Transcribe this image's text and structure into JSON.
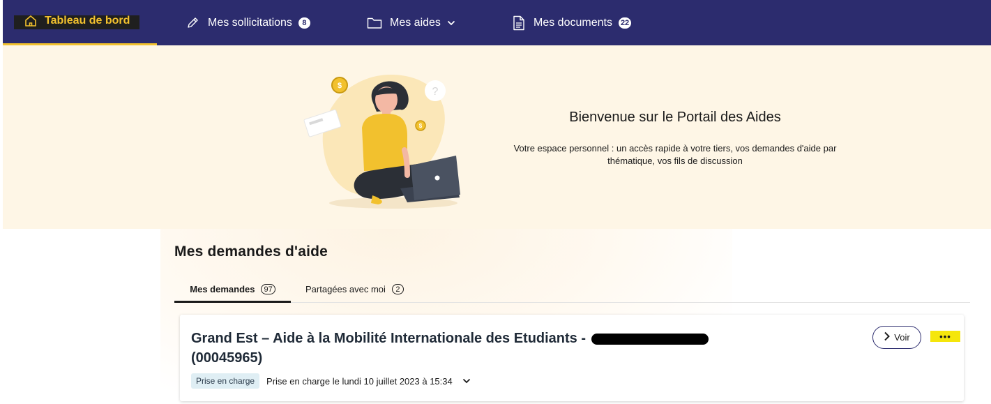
{
  "nav": {
    "home_label": "Tableau de bord",
    "items": [
      {
        "label": "Mes sollicitations",
        "badge": "8"
      },
      {
        "label": "Mes aides"
      },
      {
        "label": "Mes documents",
        "badge": "22"
      }
    ],
    "colors": {
      "background": "#2c2c6e",
      "active": "#f2c12e"
    }
  },
  "hero": {
    "title": "Bienvenue sur le Portail des Aides",
    "subtitle": "Votre espace personnel : un accès rapide à votre tiers, vos demandes d'aide par thématique, vos fils de discussion",
    "illustration": "woman-with-laptop-illustration"
  },
  "section": {
    "title": "Mes demandes d'aide"
  },
  "tabs": [
    {
      "label": "Mes demandes",
      "count": "97",
      "active": true
    },
    {
      "label": "Partagées avec moi",
      "count": "2",
      "active": false
    }
  ],
  "card": {
    "title": "Grand Est – Aide à la Mobilité Internationale des Etudiants -",
    "reference": "(00045965)",
    "voir_label": "Voir",
    "more_label": "•••",
    "status_badge": "Prise en charge",
    "status_text": "Prise en charge le lundi 10 juillet 2023 à 15:34"
  }
}
